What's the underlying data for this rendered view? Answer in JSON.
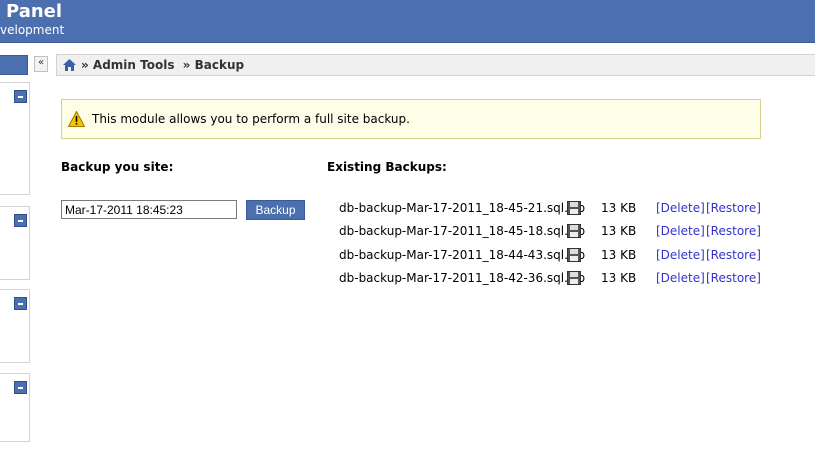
{
  "header": {
    "title": "Panel",
    "subtitle": "velopment"
  },
  "sidebar": {
    "collapse_label": "«"
  },
  "breadcrumb": {
    "items": [
      "» Admin Tools",
      "» Backup"
    ]
  },
  "notice": {
    "message": "This module allows you to perform a full site backup."
  },
  "backup_form": {
    "heading": "Backup you site:",
    "date_value": "Mar-17-2011 18:45:23",
    "button_label": "Backup"
  },
  "existing": {
    "heading": "Existing Backups:",
    "delete_label": "[Delete]",
    "restore_label": "[Restore]",
    "rows": [
      {
        "file": "db-backup-Mar-17-2011_18-45-21.sql.zip",
        "size": "13 KB"
      },
      {
        "file": "db-backup-Mar-17-2011_18-45-18.sql.zip",
        "size": "13 KB"
      },
      {
        "file": "db-backup-Mar-17-2011_18-44-43.sql.zip",
        "size": "13 KB"
      },
      {
        "file": "db-backup-Mar-17-2011_18-42-36.sql.zip",
        "size": "13 KB"
      }
    ]
  },
  "icons": {
    "home": "home-icon",
    "warning": "warning-icon",
    "disk": "floppy-disk-icon",
    "minus": "minus-icon"
  },
  "colors": {
    "header_bg": "#4c6faf",
    "link": "#3333cc",
    "notice_bg": "#fdfde8",
    "notice_border": "#d9d28a"
  }
}
